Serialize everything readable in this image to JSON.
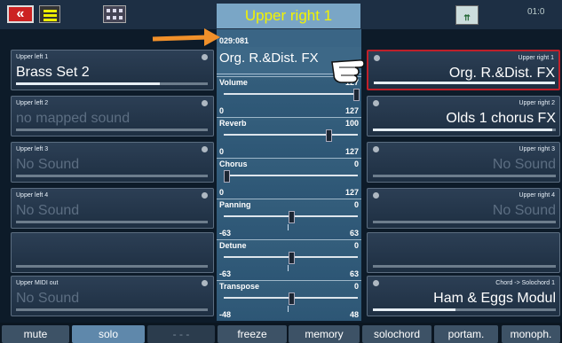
{
  "header": {
    "title": "Upper right 1",
    "back_label": "«",
    "time": "01:0",
    "right_icon_text": "⇈"
  },
  "left_panels": [
    {
      "label": "Upper left 1",
      "name": "Brass Set 2",
      "style": "bright",
      "bar_fill": 0.75
    },
    {
      "label": "Upper left 2",
      "name": "no mapped sound",
      "style": "dim",
      "bar_fill": 0.0
    },
    {
      "label": "Upper left 3",
      "name": "No Sound",
      "style": "dim",
      "bar_fill": 0.0
    },
    {
      "label": "Upper left 4",
      "name": "No Sound",
      "style": "dim",
      "bar_fill": 0.0
    },
    {
      "label": "",
      "name": "",
      "style": "dim",
      "bar_fill": 0.0
    },
    {
      "label": "Upper MIDI out",
      "name": "No Sound",
      "style": "dim",
      "bar_fill": 0.0
    }
  ],
  "right_panels": [
    {
      "label": "Upper right 1",
      "name": "Org. R.&Dist. FX",
      "style": "bright",
      "selected": true,
      "bar_fill": 1.0
    },
    {
      "label": "Upper right 2",
      "name": "Olds 1 chorus FX",
      "style": "bright",
      "bar_fill": 0.98
    },
    {
      "label": "Upper right 3",
      "name": "No Sound",
      "style": "dim",
      "bar_fill": 0.0
    },
    {
      "label": "Upper right 4",
      "name": "No Sound",
      "style": "dim",
      "bar_fill": 0.0
    },
    {
      "label": "",
      "name": "",
      "style": "dim",
      "bar_fill": 0.0
    },
    {
      "label": "Chord -> Solochord 1",
      "name": "Ham & Eggs Modul",
      "style": "bright",
      "bar_fill": 0.45
    }
  ],
  "center": {
    "position": "029:081",
    "sound_name": "Org. R.&Dist. FX",
    "sliders": [
      {
        "label": "Volume",
        "value": "127",
        "min": "0",
        "max": "127",
        "fraction": 1.0,
        "bipolar": false
      },
      {
        "label": "Reverb",
        "value": "100",
        "min": "0",
        "max": "127",
        "fraction": 0.787,
        "bipolar": false
      },
      {
        "label": "Chorus",
        "value": "0",
        "min": "0",
        "max": "127",
        "fraction": 0.0,
        "bipolar": false
      },
      {
        "label": "Panning",
        "value": "0",
        "min": "-63",
        "max": "63",
        "fraction": 0.5,
        "bipolar": true
      },
      {
        "label": "Detune",
        "value": "0",
        "min": "-63",
        "max": "63",
        "fraction": 0.5,
        "bipolar": true
      },
      {
        "label": "Transpose",
        "value": "0",
        "min": "-48",
        "max": "48",
        "fraction": 0.5,
        "bipolar": true
      }
    ]
  },
  "bottom_buttons": [
    {
      "label": "mute",
      "state": "normal"
    },
    {
      "label": "solo",
      "state": "active"
    },
    {
      "label": "- - -",
      "state": "blank"
    },
    {
      "label": "freeze",
      "state": "normal"
    },
    {
      "label": "memory",
      "state": "normal"
    },
    {
      "label": "solochord",
      "state": "normal"
    },
    {
      "label": "portam.",
      "state": "normal"
    },
    {
      "label": "monoph.",
      "state": "normal"
    }
  ],
  "colors": {
    "title_text": "#f3f300",
    "selected_border": "#c0202a",
    "arrow": "#f0902a"
  }
}
